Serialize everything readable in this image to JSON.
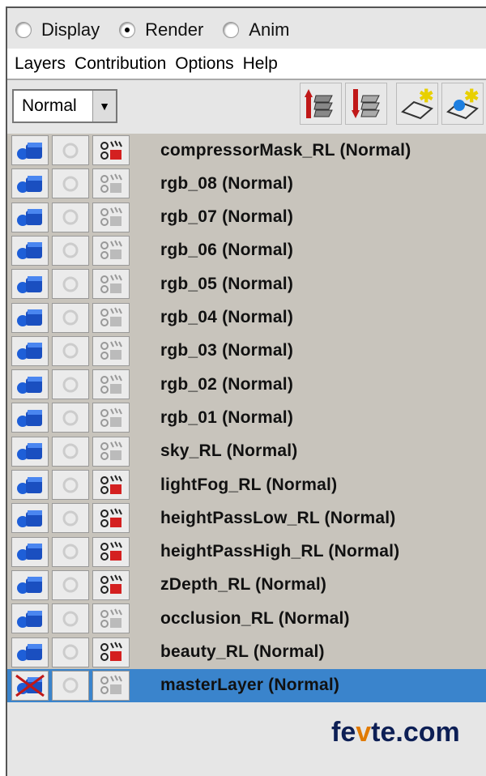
{
  "mode_radios": [
    {
      "label": "Display",
      "selected": false
    },
    {
      "label": "Render",
      "selected": true
    },
    {
      "label": "Anim",
      "selected": false
    }
  ],
  "menu": [
    "Layers",
    "Contribution",
    "Options",
    "Help"
  ],
  "toolbar": {
    "blend_mode": "Normal",
    "buttons": [
      "move-layer-up-icon",
      "move-layer-down-icon",
      "new-empty-layer-icon",
      "new-layer-from-selected-icon"
    ]
  },
  "layers": [
    {
      "name": "compressorMask_RL (Normal)",
      "renderable": true,
      "selected": false
    },
    {
      "name": "rgb_08 (Normal)",
      "renderable": false,
      "selected": false
    },
    {
      "name": "rgb_07 (Normal)",
      "renderable": false,
      "selected": false
    },
    {
      "name": "rgb_06 (Normal)",
      "renderable": false,
      "selected": false
    },
    {
      "name": "rgb_05 (Normal)",
      "renderable": false,
      "selected": false
    },
    {
      "name": "rgb_04 (Normal)",
      "renderable": false,
      "selected": false
    },
    {
      "name": "rgb_03 (Normal)",
      "renderable": false,
      "selected": false
    },
    {
      "name": "rgb_02 (Normal)",
      "renderable": false,
      "selected": false
    },
    {
      "name": "rgb_01 (Normal)",
      "renderable": false,
      "selected": false
    },
    {
      "name": "sky_RL (Normal)",
      "renderable": false,
      "selected": false
    },
    {
      "name": "lightFog_RL (Normal)",
      "renderable": true,
      "selected": false
    },
    {
      "name": "heightPassLow_RL (Normal)",
      "renderable": true,
      "selected": false
    },
    {
      "name": "heightPassHigh_RL (Normal)",
      "renderable": true,
      "selected": false
    },
    {
      "name": "zDepth_RL (Normal)",
      "renderable": true,
      "selected": false
    },
    {
      "name": "occlusion_RL (Normal)",
      "renderable": false,
      "selected": false
    },
    {
      "name": "beauty_RL (Normal)",
      "renderable": true,
      "selected": false
    },
    {
      "name": "masterLayer (Normal)",
      "renderable": false,
      "selected": true,
      "visibility_off": true
    }
  ],
  "watermark": "fevte.com",
  "colors": {
    "selection": "#3a84cc",
    "list_bg": "#c8c4bc",
    "icon_blue": "#1e5fd8",
    "render_red": "#d42020"
  }
}
